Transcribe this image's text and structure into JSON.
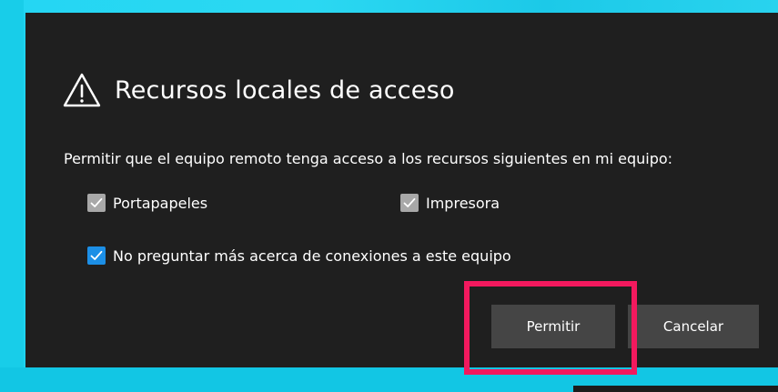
{
  "dialog": {
    "title": "Recursos locales de acceso",
    "description": "Permitir que el equipo remoto tenga acceso a los recursos siguientes en mi equipo:",
    "title_icon": "warning-triangle-icon"
  },
  "options": {
    "clipboard": {
      "label": "Portapapeles",
      "checked": true
    },
    "printer": {
      "label": "Impresora",
      "checked": true
    },
    "dont_ask": {
      "label": "No preguntar más acerca de conexiones a este equipo",
      "checked": true
    }
  },
  "buttons": {
    "allow_label": "Permitir",
    "cancel_label": "Cancelar"
  },
  "colors": {
    "dialog_bg": "#1f1f1f",
    "button_bg": "#454545",
    "accent_checkbox": "#1c8fe6",
    "disabled_checkbox": "#a8a8a8",
    "highlight": "#f2195e",
    "background": "#1fd3f0"
  }
}
